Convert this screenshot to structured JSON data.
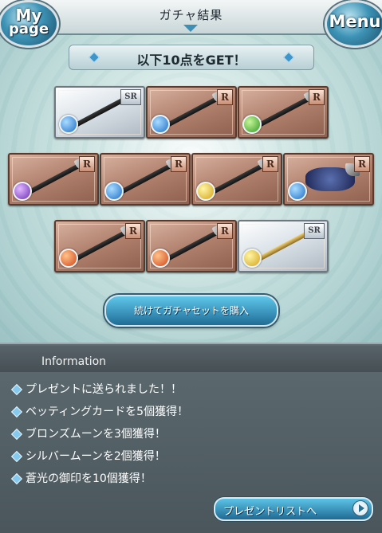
{
  "header": {
    "title": "ガチャ結果",
    "mypage_label": [
      "My",
      "page"
    ],
    "menu_label": "Menu"
  },
  "banner": {
    "text": "以下10点をGET！"
  },
  "items": [
    {
      "rarity": "SR",
      "element": "water",
      "element_color": "#1f6fc8",
      "weapon": "spear"
    },
    {
      "rarity": "R",
      "element": "water",
      "element_color": "#1f6fc8",
      "weapon": "sword"
    },
    {
      "rarity": "R",
      "element": "wind",
      "element_color": "#2f9a24",
      "weapon": "gun"
    },
    {
      "rarity": "R",
      "element": "dark",
      "element_color": "#6a2fb5",
      "weapon": "sword"
    },
    {
      "rarity": "R",
      "element": "water",
      "element_color": "#1f6fc8",
      "weapon": "bow"
    },
    {
      "rarity": "R",
      "element": "light",
      "element_color": "#d3a317",
      "weapon": "gauntlet"
    },
    {
      "rarity": "R",
      "element": "water",
      "element_color": "#1f6fc8",
      "weapon": "summon"
    },
    {
      "rarity": "R",
      "element": "fire",
      "element_color": "#d2461a",
      "weapon": "bow"
    },
    {
      "rarity": "R",
      "element": "fire",
      "element_color": "#d2461a",
      "weapon": "scythe"
    },
    {
      "rarity": "SR",
      "element": "light",
      "element_color": "#d3a317",
      "weapon": "claw"
    }
  ],
  "continue_button": {
    "label": "続けてガチャセットを購入"
  },
  "information": {
    "title": "Information",
    "messages": [
      "プレゼントに送られました！！",
      "ベッティングカードを5個獲得！",
      "ブロンズムーンを3個獲得！",
      "シルバームーンを2個獲得！",
      "蒼光の御印を10個獲得！"
    ]
  },
  "gift_button": {
    "label": "プレゼントリストへ"
  },
  "colors": {
    "accent": "#3f95c9",
    "panel": "#4a565b"
  }
}
